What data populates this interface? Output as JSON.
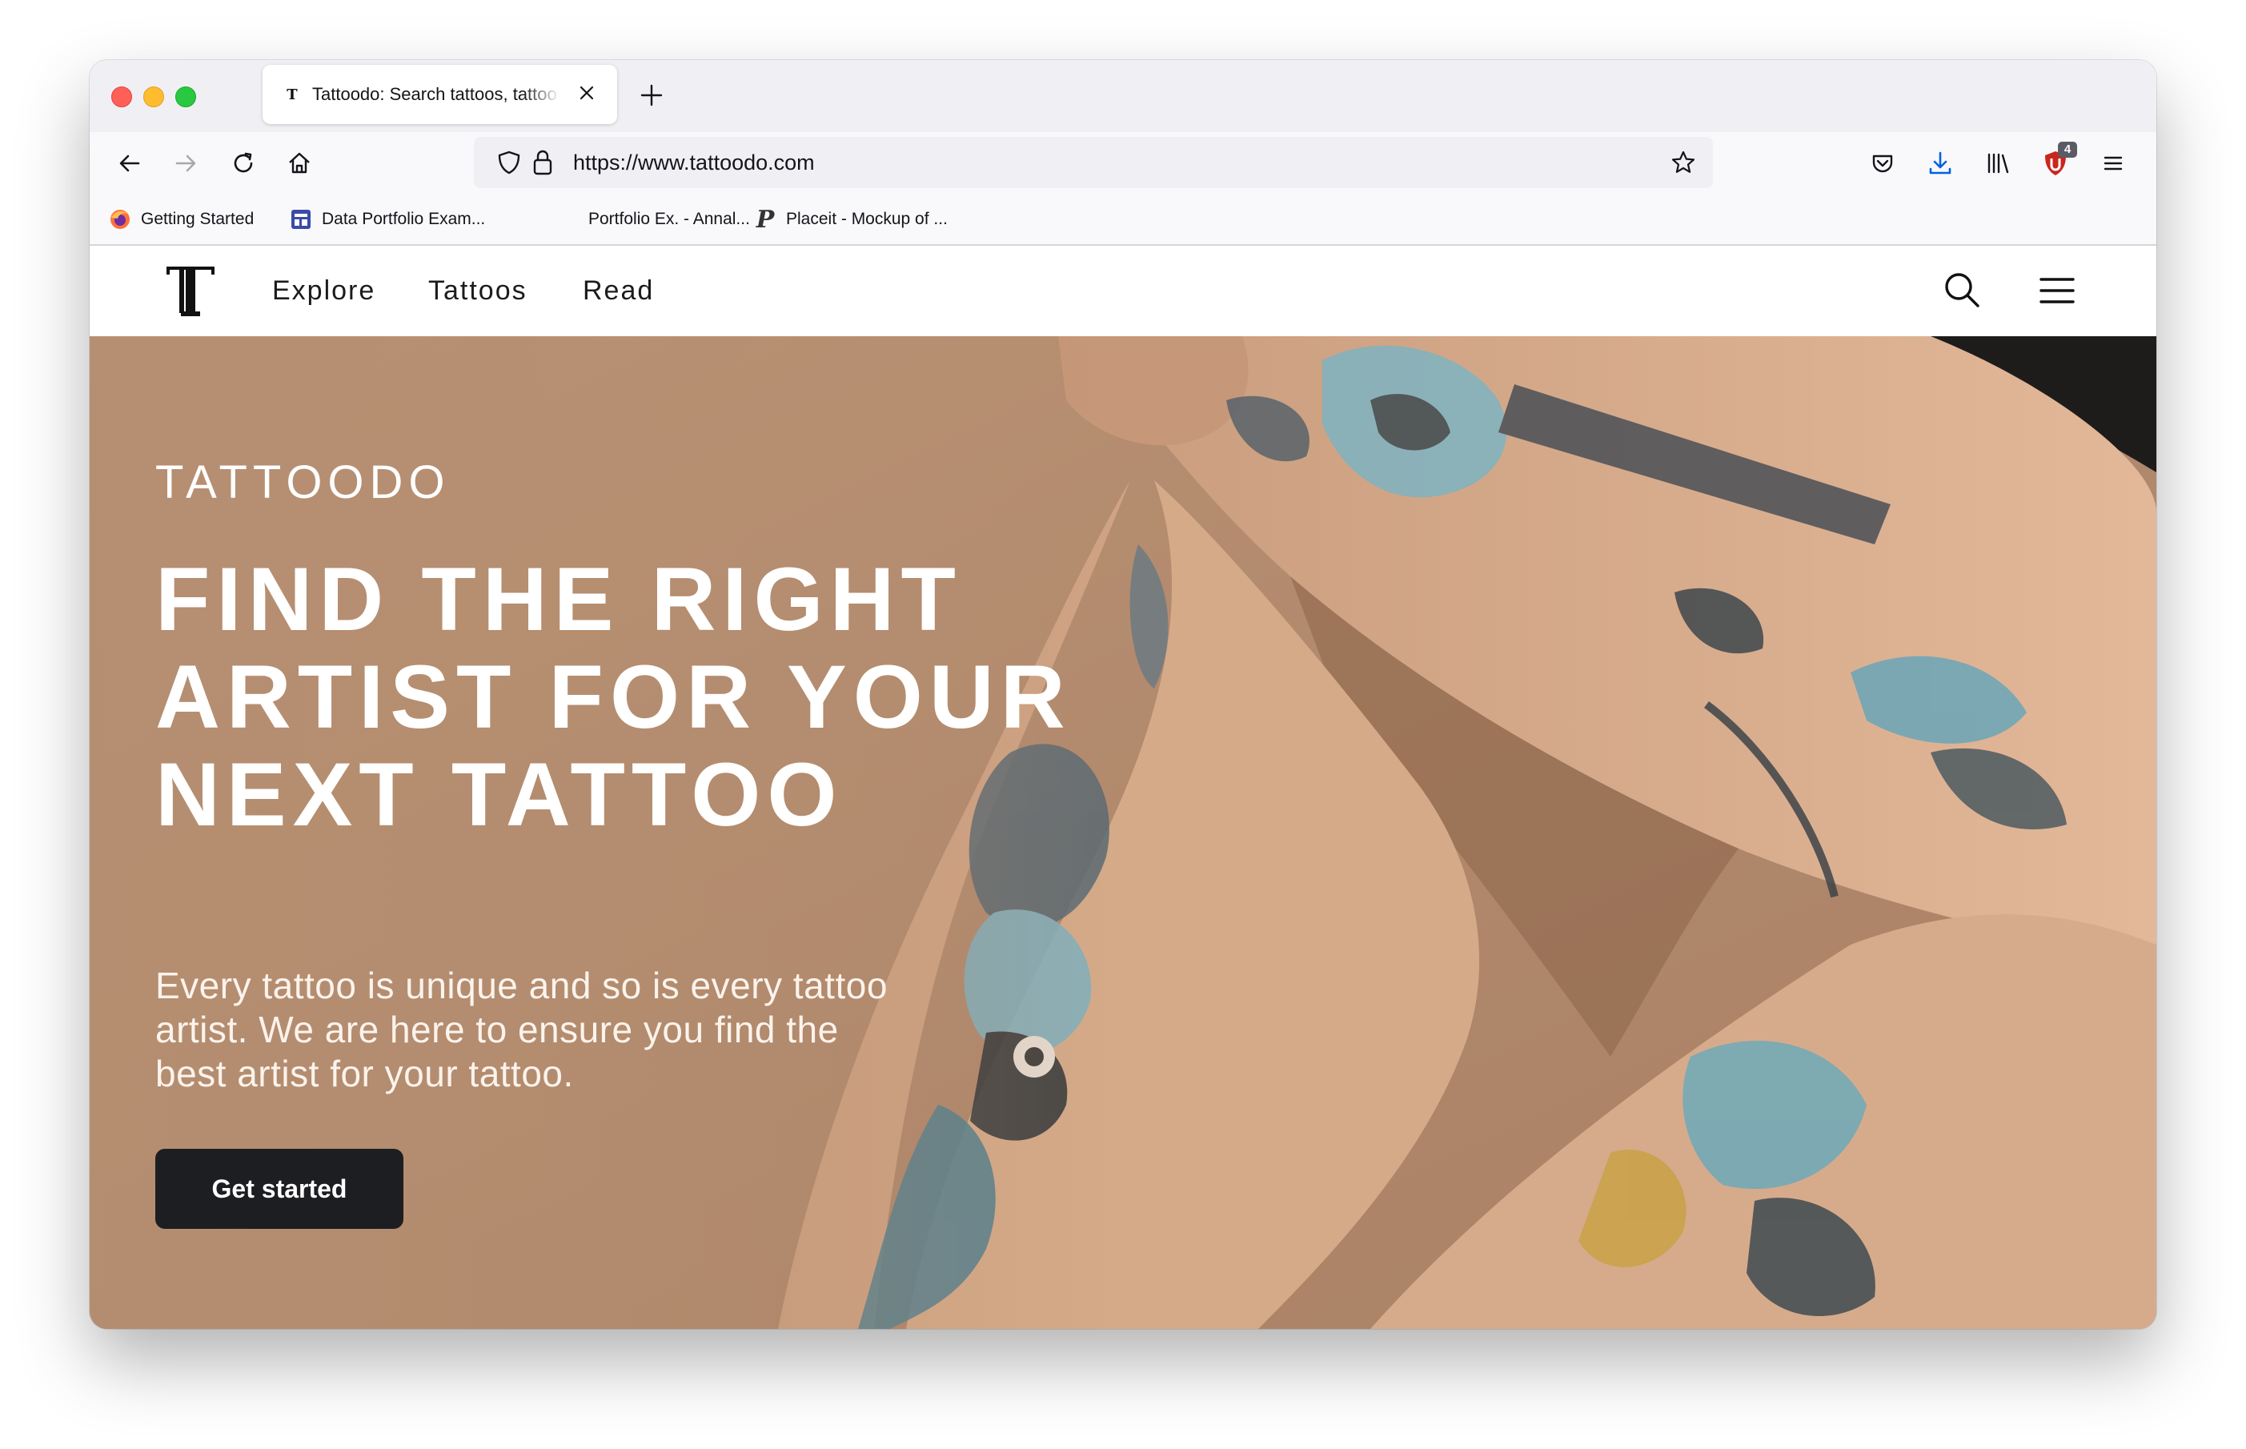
{
  "browser": {
    "tab": {
      "title": "Tattoodo: Search tattoos, tattoo",
      "favicon": "T"
    },
    "url": "https://www.tattoodo.com",
    "addon_badge": "4",
    "bookmarks": [
      {
        "label": "Getting Started",
        "icon": "firefox-icon"
      },
      {
        "label": "Data Portfolio Exam...",
        "icon": "layout-icon"
      },
      {
        "label": "Portfolio Ex. - Annal...",
        "icon": "none"
      },
      {
        "label": "Placeit - Mockup of ...",
        "icon": "placeit-p-icon"
      }
    ]
  },
  "site": {
    "nav": [
      {
        "label": "Explore"
      },
      {
        "label": "Tattoos"
      },
      {
        "label": "Read"
      }
    ],
    "hero": {
      "eyebrow": "TATTOODO",
      "headline": [
        "FIND THE RIGHT",
        "ARTIST FOR YOUR",
        "NEXT TATTOO"
      ],
      "subtext": [
        "Every tattoo is unique and so is every tattoo",
        "artist. We are here to ensure you find the",
        "best artist for your tattoo."
      ],
      "cta": "Get started"
    }
  },
  "colors": {
    "hero_bg": "#b58e71",
    "skin": "#d9ae8e",
    "button_bg": "#1d1e22",
    "download_accent": "#0061e0",
    "ublock_red": "#c9261d"
  }
}
